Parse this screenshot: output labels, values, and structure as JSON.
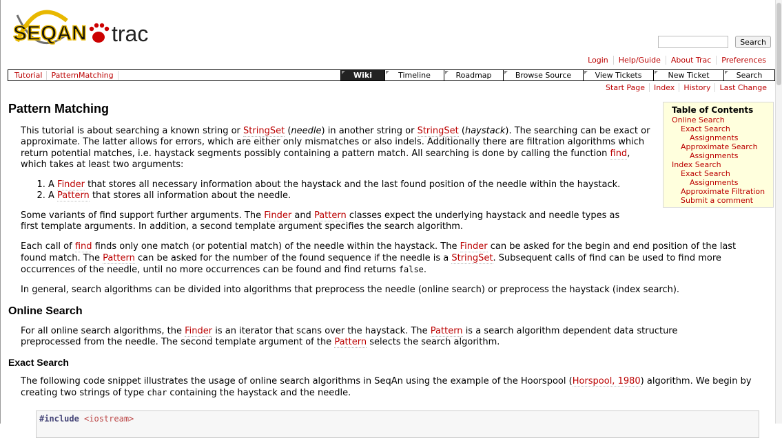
{
  "header": {
    "logo_text_seqan": "SEQAN",
    "logo_text_trac": "trac",
    "search_placeholder": "",
    "search_button": "Search"
  },
  "metanav": [
    "Login",
    "Help/Guide",
    "About Trac",
    "Preferences"
  ],
  "breadcrumbs": [
    "Tutorial",
    "PatternMatching"
  ],
  "tabs": [
    "Wiki",
    "Timeline",
    "Roadmap",
    "Browse Source",
    "View Tickets",
    "New Ticket",
    "Search"
  ],
  "ctxtnav": [
    "Start Page",
    "Index",
    "History",
    "Last Change"
  ],
  "toc": {
    "title": "Table of Contents",
    "items": [
      {
        "label": "Online Search",
        "level": 1
      },
      {
        "label": "Exact Search",
        "level": 2
      },
      {
        "label": "Assignments",
        "level": 3
      },
      {
        "label": "Approximate Search",
        "level": 2
      },
      {
        "label": "Assignments",
        "level": 3
      },
      {
        "label": "Index Search",
        "level": 1
      },
      {
        "label": "Exact Search",
        "level": 2
      },
      {
        "label": "Assignments",
        "level": 3
      },
      {
        "label": "Approximate Filtration",
        "level": 2
      },
      {
        "label": "Submit a comment",
        "level": 2
      }
    ]
  },
  "content": {
    "title": "Pattern Matching",
    "p1": {
      "a": "This tutorial is about searching a known string or ",
      "link1": "StringSet",
      "b": " (",
      "em1": "needle",
      "c": ") in another string or ",
      "link2": "StringSet",
      "d": " (",
      "em2": "haystack",
      "e": "). The searching can be exact or approximate. The latter allows for errors, which are either only mismatches or also indels. Additionally there are filtration algorithms which return potential matches, i.e. haystack segments possibly containing a pattern match. All searching is done by calling the function ",
      "link3": "find",
      "f": ", which takes at least two arguments:"
    },
    "list": [
      {
        "pre": "A ",
        "link": "Finder",
        "post": " that stores all necessary information about the haystack and the last found position of the needle within the haystack."
      },
      {
        "pre": "A ",
        "link": "Pattern",
        "post": " that stores all information about the needle."
      }
    ],
    "p2": {
      "a": "Some variants of find support further arguments. The ",
      "link1": "Finder",
      "b": " and ",
      "link2": "Pattern",
      "c": " classes expect the underlying haystack and needle types as first template arguments. In addition, a second template argument specifies the search algorithm."
    },
    "p3": {
      "a": "Each call of ",
      "link1": "find",
      "b": " finds only one match (or potential match) of the needle within the haystack. The ",
      "link2": "Finder",
      "c": " can be asked for the begin and end position of the last found match. The ",
      "link3": "Pattern",
      "d": " can be asked for the number of the found sequence if the needle is a ",
      "link4": "StringSet",
      "e": ". Subsequent calls of find can be used to find more occurrences of the needle, until no more occurrences can be found and find returns ",
      "code": "false",
      "f": "."
    },
    "p4": "In general, search algorithms can be divided into algorithms that preprocess the needle (online search) or preprocess the haystack (index search).",
    "h_online": "Online Search",
    "p5": {
      "a": "For all online search algorithms, the ",
      "link1": "Finder",
      "b": " is an iterator that scans over the haystack. The ",
      "link2": "Pattern",
      "c": " is a search algorithm dependent data structure preprocessed from the needle. The second template argument of the ",
      "link3": "Pattern",
      "d": " selects the search algorithm."
    },
    "h_exact": "Exact Search",
    "p6": {
      "a": "The following code snippet illustrates the usage of online search algorithms in SeqAn using the example of the Hoorspool (",
      "link1": "Horspool, 1980",
      "b": ") algorithm. We begin by creating two strings of type ",
      "code": "char",
      "c": " containing the haystack and the needle."
    },
    "code_line1_kw": "#include",
    "code_line1_inc": "<iostream>"
  },
  "colors": {
    "link": "#bb0000",
    "toc_bg": "#ffffdd",
    "active_tab": "#222222"
  }
}
